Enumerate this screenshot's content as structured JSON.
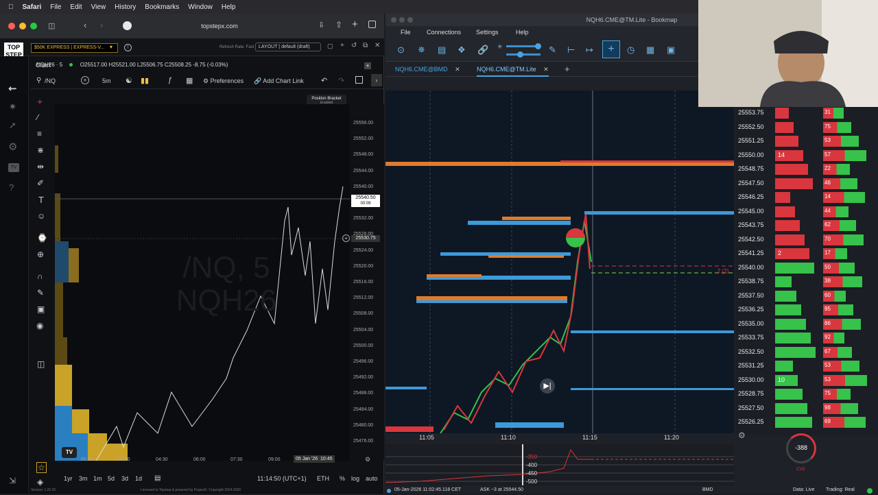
{
  "menubar": {
    "app": "Safari",
    "items": [
      "File",
      "Edit",
      "View",
      "History",
      "Bookmarks",
      "Window",
      "Help"
    ]
  },
  "safari": {
    "url": "topstepx.com",
    "account": "$50K EXPRESS | EXPRESS-V...",
    "refresh_rate": "Refresh Rate: Fast",
    "layout": "LAYOUT | default (draft)",
    "chart_tab": "Chart",
    "symbol": "/NQ",
    "interval": "5m",
    "preferences": "Preferences",
    "add_chart_link": "Add Chart Link",
    "position_bracket": "Position Bracket",
    "bracket_enabled": "Enabled",
    "ohlc_symbol": "NQH26 · 5",
    "ohlc": "O25517.00 H25521.00 L25506.75 C25508.25 -8.75 (-0.03%)",
    "watermark_line1": "/NQ, 5",
    "watermark_line2": "NQH26",
    "last_price": "25540.50",
    "last_price_timer": "00:09",
    "cursor_price": "25530.75",
    "time_labels": [
      "01:30",
      "03:00",
      "04:30",
      "06:00",
      "07:30",
      "09:00",
      "05 Jan '26",
      "10:45"
    ],
    "ranges": [
      "1yr",
      "3m",
      "1m",
      "5d",
      "3d",
      "1d"
    ],
    "clock": "11:14:50 (UTC+1)",
    "session": "ETH",
    "percent": "%",
    "log": "log",
    "auto": "auto",
    "version": "Version: 1.22.30",
    "license": "Licensed to Topstep & powered by ProjectX. Copyright 2024-2026"
  },
  "price_axis": {
    "ticks": [
      "25556.00",
      "25552.00",
      "25548.00",
      "25544.00",
      "25540.00",
      "25536.00",
      "25532.00",
      "25528.00",
      "25524.00",
      "25520.00",
      "25516.00",
      "25512.00",
      "25508.00",
      "25504.00",
      "25500.00",
      "25496.00",
      "25492.00",
      "25488.00",
      "25484.00",
      "25480.00",
      "25476.00"
    ]
  },
  "bookmap": {
    "title": "NQH6.CME@TM.Lite",
    "app": "Bookmap",
    "menu": [
      "File",
      "Connections",
      "Settings",
      "Help"
    ],
    "tabs": [
      "NQH6.CME@BMD",
      "NQH6.CME@TM.Lite"
    ],
    "time_labels": [
      "11:05",
      "11:10",
      "11:15",
      "11:20"
    ],
    "ladder_prices": [
      "25553.75",
      "25552.50",
      "25551.25",
      "25550.00",
      "25548.75",
      "25547.50",
      "25546.25",
      "25545.00",
      "25543.75",
      "25542.50",
      "25541.25",
      "25540.00",
      "25538.75",
      "25537.50",
      "25536.25",
      "25535.00",
      "25533.75",
      "25532.50",
      "25531.25",
      "25530.00",
      "25528.75",
      "25527.50",
      "25526.25"
    ],
    "ladder_bid": [
      "",
      "",
      "",
      "14",
      "",
      "",
      "",
      "",
      "",
      "",
      "2",
      "",
      "",
      "",
      "",
      "",
      "",
      "",
      "",
      "10",
      "",
      "",
      ""
    ],
    "ladder_right": [
      "31",
      "75",
      "53",
      "57",
      "22",
      "46",
      "14",
      "44",
      "62",
      "70",
      "17",
      "50",
      "38",
      "60",
      "95",
      "86",
      "92",
      "67",
      "53",
      "53",
      "75",
      "98",
      "69"
    ],
    "order_marker": "2 (2)",
    "cvd_levels": [
      "-350",
      "-400",
      "-450",
      "-500"
    ],
    "cvd_value": "-388",
    "cvd_label": "CVD",
    "status_time": "05-Jan-2026 11:02:45.118 CET",
    "status_ask": "ASK ~3 at 25544.50",
    "status_feed": "BMD",
    "status_data": "Data: Live",
    "status_trading": "Trading: Real"
  },
  "colors": {
    "accent_blue": "#4aa3df",
    "bid_green": "#36c24b",
    "ask_red": "#d9363e",
    "orange": "#e07a2c",
    "gold": "#c9a227"
  }
}
